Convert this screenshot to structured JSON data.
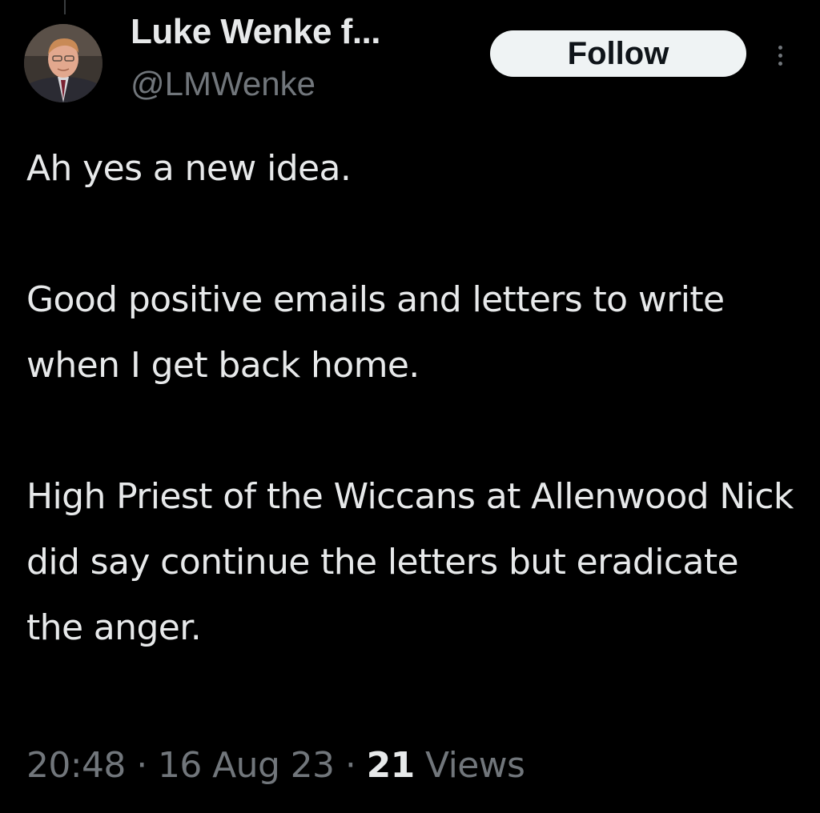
{
  "author": {
    "display_name": "Luke Wenke f...",
    "handle": "@LMWenke",
    "avatar_icon": "user-avatar"
  },
  "actions": {
    "follow_label": "Follow",
    "more_icon": "more-vertical-icon"
  },
  "tweet": {
    "paragraphs": [
      "Ah yes a new idea.",
      "Good positive emails and letters to write when I get back home.",
      "High Priest of the Wiccans at Allenwood Nick did say continue the letters but eradicate the anger."
    ]
  },
  "meta": {
    "time": "20:48",
    "separator": "·",
    "date": "16 Aug 23",
    "views_count": "21",
    "views_label": "Views"
  },
  "colors": {
    "background": "#000000",
    "text_primary": "#e7e9ea",
    "text_secondary": "#71767b",
    "follow_button_bg": "#eff3f4",
    "follow_button_text": "#0f1419"
  }
}
